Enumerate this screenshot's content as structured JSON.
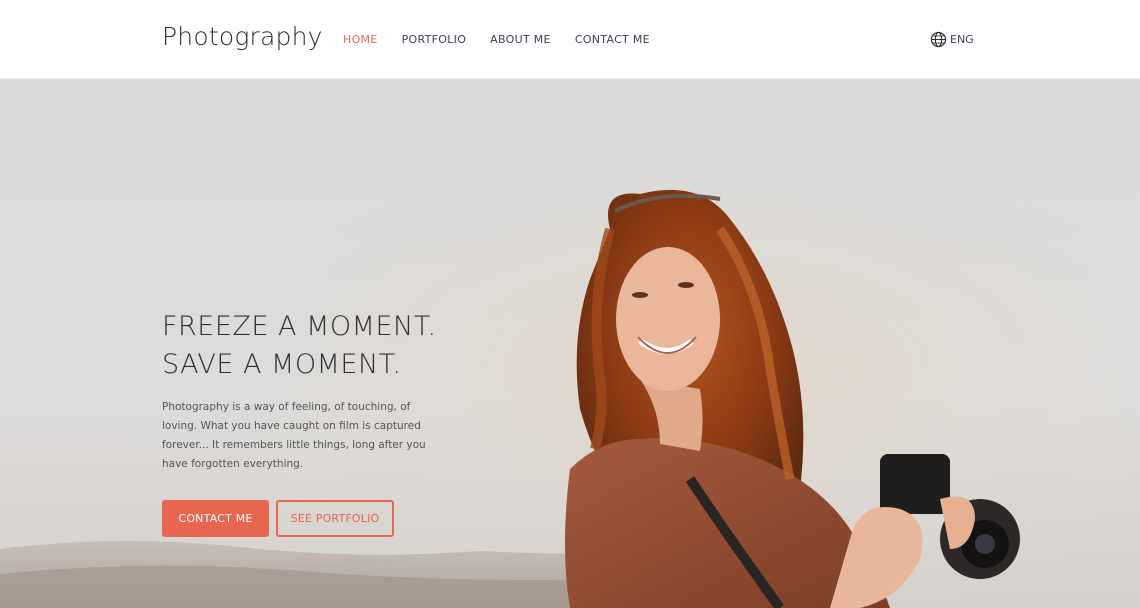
{
  "header": {
    "brand": "Photography",
    "nav": [
      "HOME",
      "PORTFOLIO",
      "ABOUT ME",
      "CONTACT ME"
    ],
    "active_nav": "HOME",
    "language": "ENG"
  },
  "hero": {
    "headline_line1": "FREEZE A MOMENT.",
    "headline_line2": "SAVE A MOMENT.",
    "description": "Photography is a way of feeling, of touching, of loving. What you have caught on film is captured forever... It remembers little things, long after you have forgotten everything.",
    "primary_button": "CONTACT ME",
    "secondary_button": "SEE PORTFOLIO"
  },
  "colors": {
    "accent": "#e8664f",
    "nav_text": "#3b4256",
    "hero_bg": "#dadad9"
  },
  "icons": {
    "language": "globe-icon",
    "hero_image": "woman-with-camera-photo"
  }
}
